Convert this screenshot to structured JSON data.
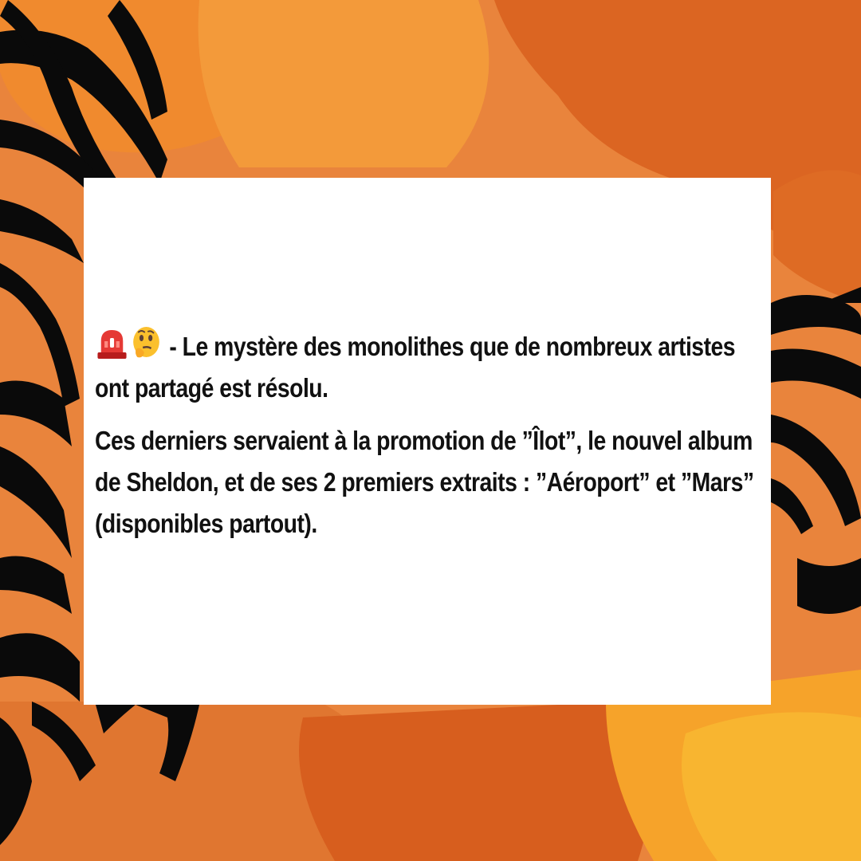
{
  "post": {
    "emojis": [
      "siren-icon",
      "thinking-face-icon"
    ],
    "headline": " - Le mystère des monolithes que de nombreux artistes ont partagé est résolu.",
    "body": "Ces derniers servaient à la promotion de ”Îlot”, le nouvel album de Sheldon, et de ses 2 premiers extraits : ”Aéroport” et ”Mars” (disponibles partout)."
  },
  "colors": {
    "background": "#e8843a",
    "background_dark": "#d9601c",
    "background_yellow": "#f6a12a",
    "palm_silhouette": "#0a0a0a",
    "card": "#ffffff",
    "text": "#111111"
  }
}
